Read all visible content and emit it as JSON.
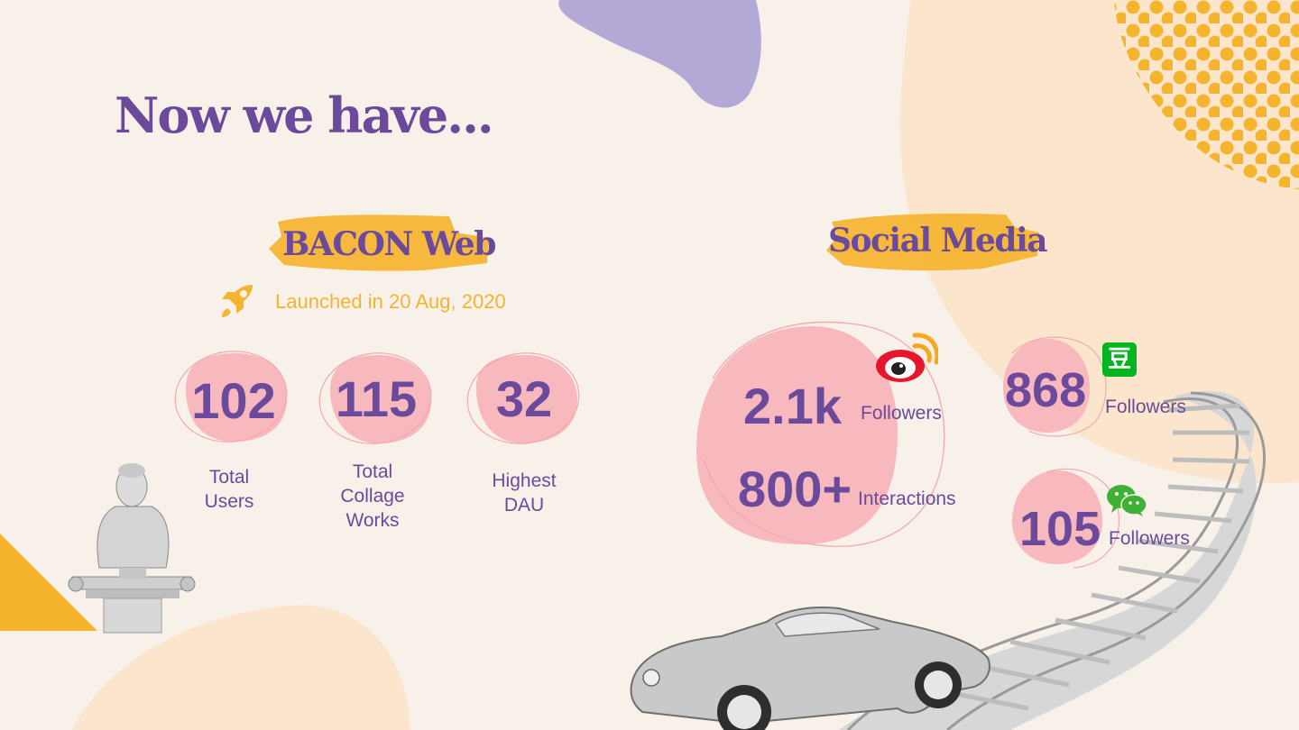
{
  "slide": {
    "title": "Now we have...",
    "colors": {
      "purple": "#6b4a9c",
      "pink": "#f7b8be",
      "yellow": "#f5b42e",
      "cream": "#fbe6cd",
      "lavender": "#b4a8d6",
      "background": "#f8f1ea"
    }
  },
  "web": {
    "heading": "BACON Web",
    "launch_icon": "rocket-icon",
    "launch_text": "Launched in 20 Aug, 2020",
    "stats": [
      {
        "value": "102",
        "label_lines": [
          "Total",
          "Users"
        ]
      },
      {
        "value": "115",
        "label_lines": [
          "Total",
          "Collage",
          "Works"
        ]
      },
      {
        "value": "32",
        "label_lines": [
          "Highest",
          "DAU"
        ]
      }
    ]
  },
  "social": {
    "heading": "Social Media",
    "weibo": {
      "icon": "weibo-icon",
      "followers_value": "2.1k",
      "followers_label": "Followers",
      "interactions_value": "800+",
      "interactions_label": "Interactions"
    },
    "douban": {
      "icon": "douban-icon",
      "icon_glyph": "豆",
      "value": "868",
      "label": "Followers"
    },
    "wechat": {
      "icon": "wechat-icon",
      "value": "105",
      "label": "Followers"
    }
  }
}
